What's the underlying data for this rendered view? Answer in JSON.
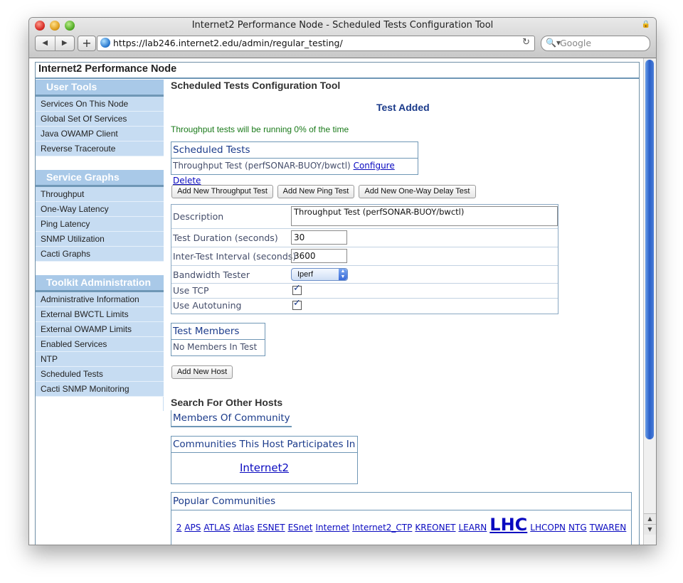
{
  "window": {
    "title": "Internet2 Performance Node - Scheduled Tests Configuration Tool"
  },
  "toolbar": {
    "url": "https://lab246.internet2.edu/admin/regular_testing/",
    "search_placeholder": "Google"
  },
  "site": {
    "title": "Internet2 Performance Node"
  },
  "sidebar": {
    "user_tools": {
      "heading": "User Tools",
      "items": [
        "Services On This Node",
        "Global Set Of Services",
        "Java OWAMP Client",
        "Reverse Traceroute"
      ]
    },
    "service_graphs": {
      "heading": "Service Graphs",
      "items": [
        "Throughput",
        "One-Way Latency",
        "Ping Latency",
        "SNMP Utilization",
        "Cacti Graphs"
      ]
    },
    "toolkit_admin": {
      "heading": "Toolkit Administration",
      "items": [
        "Administrative Information",
        "External BWCTL Limits",
        "External OWAMP Limits",
        "Enabled Services",
        "NTP",
        "Scheduled Tests",
        "Cacti SNMP Monitoring"
      ]
    }
  },
  "main": {
    "title": "Scheduled Tests Configuration Tool",
    "status_message": "Test Added",
    "running_note": "Throughput tests will be running 0% of the time",
    "scheduled_tests": {
      "heading": "Scheduled Tests",
      "row": {
        "name": "Throughput Test (perfSONAR-BUOY/bwctl)",
        "configure": "Configure",
        "delete": "Delete"
      }
    },
    "add_buttons": [
      "Add New Throughput Test",
      "Add New Ping Test",
      "Add New One-Way Delay Test"
    ],
    "form": {
      "description_label": "Description",
      "description_value": "Throughput Test (perfSONAR-BUOY/bwctl)",
      "duration_label": "Test Duration (seconds)",
      "duration_value": "30",
      "interval_label": "Inter-Test Interval (seconds)",
      "interval_value": "3600",
      "tester_label": "Bandwidth Tester",
      "tester_value": "Iperf",
      "tcp_label": "Use TCP",
      "tcp_checked": true,
      "autotune_label": "Use Autotuning",
      "autotune_checked": true
    },
    "members": {
      "heading": "Test Members",
      "empty": "No Members In Test",
      "add_button": "Add New Host"
    },
    "search_heading": "Search For Other Hosts",
    "community_members": "Members Of Community",
    "participates": {
      "heading": "Communities This Host Participates In",
      "link": "Internet2"
    },
    "popular": {
      "heading": "Popular Communities",
      "tags": [
        "2",
        "APS",
        "ATLAS",
        "Atlas",
        "ESNET",
        "ESnet",
        "Internet",
        "Internet2_CTP",
        "KREONET",
        "LEARN",
        "LHC",
        "LHCOPN",
        "NTG",
        "TWAREN"
      ]
    }
  }
}
